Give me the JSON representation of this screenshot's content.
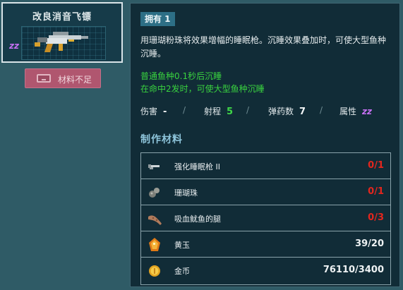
{
  "item": {
    "title": "改良消音飞镖",
    "attribute_icon": "sleep-zz-icon",
    "attribute_glyph": "zz"
  },
  "craft_button": {
    "label": "材料不足",
    "icon": "key-icon",
    "enabled": false
  },
  "details": {
    "owned_label": "拥有 1",
    "description": "用珊瑚粉珠将效果增幅的睡眠枪。沉睡效果叠加时，可使大型鱼种沉睡。",
    "effects": [
      "普通鱼种0.1秒后沉睡",
      "在命中2发时，可使大型鱼种沉睡"
    ],
    "stats": [
      {
        "label": "伤害",
        "value": "-",
        "color": "white"
      },
      {
        "label": "射程",
        "value": "5",
        "color": "green"
      },
      {
        "label": "弹药数",
        "value": "7",
        "color": "white"
      },
      {
        "label": "属性",
        "value": "zz",
        "color": "purple"
      }
    ],
    "separator": "/"
  },
  "materials": {
    "title": "制作材料",
    "items": [
      {
        "name": "强化睡眠枪 II",
        "count": "0/1",
        "status": "insufficient",
        "icon": "gun-icon"
      },
      {
        "name": "珊瑚珠",
        "count": "0/1",
        "status": "insufficient",
        "icon": "coral-pearl-icon"
      },
      {
        "name": "吸血鱿鱼的腿",
        "count": "0/3",
        "status": "insufficient",
        "icon": "squid-leg-icon"
      },
      {
        "name": "黄玉",
        "count": "39/20",
        "status": "sufficient",
        "icon": "topaz-icon"
      },
      {
        "name": "金币",
        "count": "76110/3400",
        "status": "sufficient",
        "icon": "gold-coin-icon"
      }
    ]
  },
  "colors": {
    "background": "#2f5b66",
    "panel": "#112c37",
    "accent_blue": "#8fc6dc",
    "effect_green": "#39d23f",
    "insufficient_red": "#e3261e",
    "sleep_purple": "#c36ff0",
    "button_pink": "#b0566f"
  }
}
